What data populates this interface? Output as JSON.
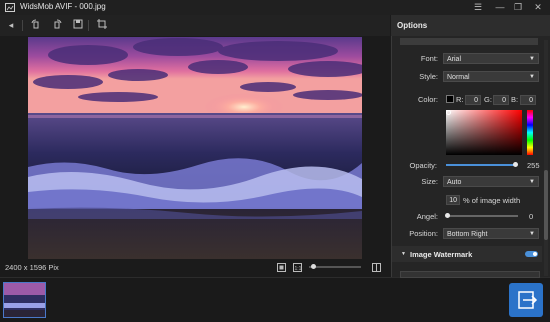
{
  "window": {
    "title": "WidsMob AVIF - 000.jpg",
    "menu_icon": "hamburger-icon",
    "minimize_icon": "minimize-icon",
    "maximize_icon": "maximize-icon",
    "close_icon": "close-icon"
  },
  "toolbar": {
    "icons": [
      "back-arrow-icon",
      "rotate-left-icon",
      "rotate-right-icon",
      "save-icon",
      "crop-icon"
    ]
  },
  "viewer": {
    "image_dimensions": "2400 x 1596 Pix",
    "zoom_level": 0.05
  },
  "options": {
    "title": "Options",
    "font": {
      "label": "Font:",
      "value": "Arial"
    },
    "style": {
      "label": "Style:",
      "value": "Normal"
    },
    "color": {
      "label": "Color:",
      "r_label": "R:",
      "r": "0",
      "g_label": "G:",
      "g": "0",
      "b_label": "B:",
      "b": "0",
      "swatch": "#000000"
    },
    "opacity": {
      "label": "Opacity:",
      "value": "255",
      "fraction": 1.0
    },
    "size": {
      "label": "Size:",
      "value": "Auto",
      "percent": "10",
      "suffix": "% of image width"
    },
    "angel": {
      "label": "Angel:",
      "value": "0",
      "fraction": 0.0
    },
    "position": {
      "label": "Position:",
      "value": "Bottom Right"
    },
    "image_watermark": {
      "label": "Image Watermark",
      "enabled": true
    }
  },
  "colors": {
    "accent": "#2b73c9",
    "panel_bg": "#252525",
    "app_bg": "#1b1b1b"
  }
}
